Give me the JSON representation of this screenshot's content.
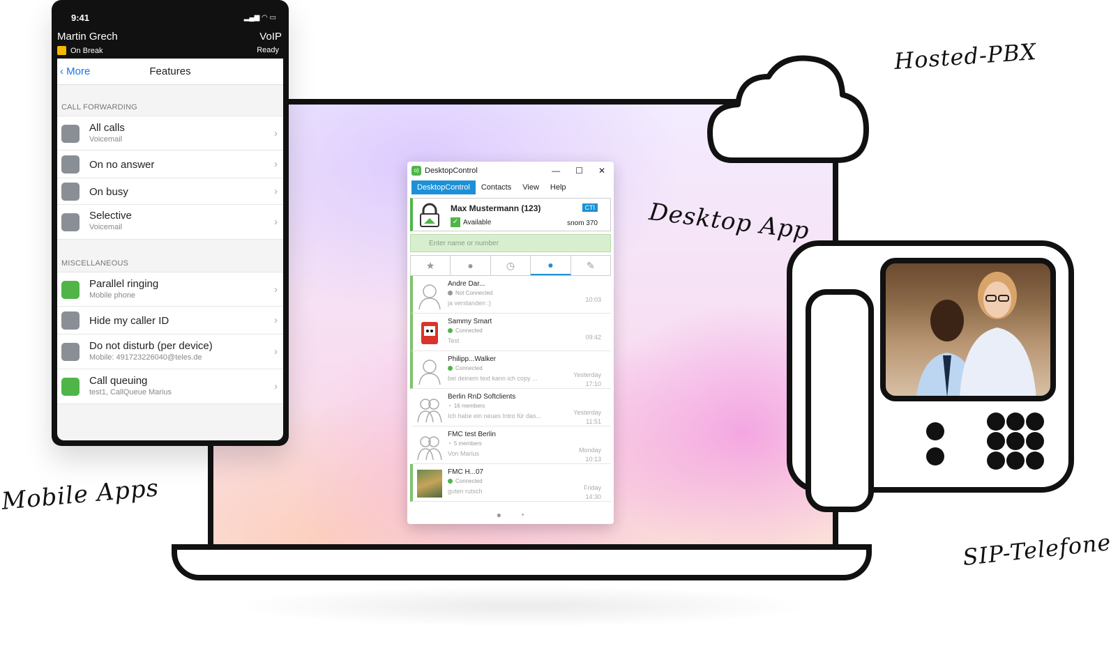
{
  "labels": {
    "hosted_pbx": "Hosted-PBX",
    "desktop_app": "Desktop App",
    "mobile_apps": "Mobile Apps",
    "sip_phones": "SIP-Telefone"
  },
  "mobile": {
    "time": "9:41",
    "user": "Martin Grech",
    "presence": "On Break",
    "line": "VoIP",
    "line_status": "Ready",
    "back_label": "More",
    "title": "Features",
    "sections": [
      {
        "header": "CALL FORWARDING",
        "rows": [
          {
            "label": "All calls",
            "sub": "Voicemail"
          },
          {
            "label": "On no answer",
            "sub": ""
          },
          {
            "label": "On busy",
            "sub": ""
          },
          {
            "label": "Selective",
            "sub": "Voicemail"
          }
        ]
      },
      {
        "header": "MISCELLANEOUS",
        "rows": [
          {
            "label": "Parallel ringing",
            "sub": "Mobile phone"
          },
          {
            "label": "Hide my caller ID",
            "sub": ""
          },
          {
            "label": "Do not disturb (per device)",
            "sub": "Mobile: 491723226040@teles.de"
          },
          {
            "label": "Call queuing",
            "sub": "test1, CallQueue Marius"
          }
        ]
      }
    ]
  },
  "desktop": {
    "window_title": "DesktopControl",
    "menu": [
      "DesktopControl",
      "Contacts",
      "View",
      "Help"
    ],
    "profile_name": "Max Mustermann (123)",
    "profile_status": "Available",
    "badge": "CTI",
    "device": "snom 370",
    "search_placeholder": "Enter name or number",
    "chats": [
      {
        "name": "Andre Dar...",
        "status": "Not Connected",
        "message": "ja verstanden :)",
        "time": "10:03",
        "date": ""
      },
      {
        "name": "Sammy Smart",
        "status": "Connected",
        "message": "Test",
        "time": "09:42",
        "date": ""
      },
      {
        "name": "Philipp...Walker",
        "status": "Connected",
        "message": "bei deinem text kann ich copy ...",
        "time": "17:10",
        "date": "Yesterday"
      },
      {
        "name": "Berlin RnD Softclients",
        "status": "16 members",
        "message": "Ich habe ein neues Intro für das...",
        "time": "11:51",
        "date": "Yesterday"
      },
      {
        "name": "FMC test Berlin",
        "status": "5 members",
        "message": "Von Marius",
        "time": "10:13",
        "date": "Monday"
      },
      {
        "name": "FMC H...07",
        "status": "Connected",
        "message": "guten rutsch",
        "time": "14:30",
        "date": "Friday"
      }
    ]
  },
  "colors": {
    "accent_green": "#4fb548",
    "accent_blue": "#1e90d6",
    "ink": "#111111"
  }
}
